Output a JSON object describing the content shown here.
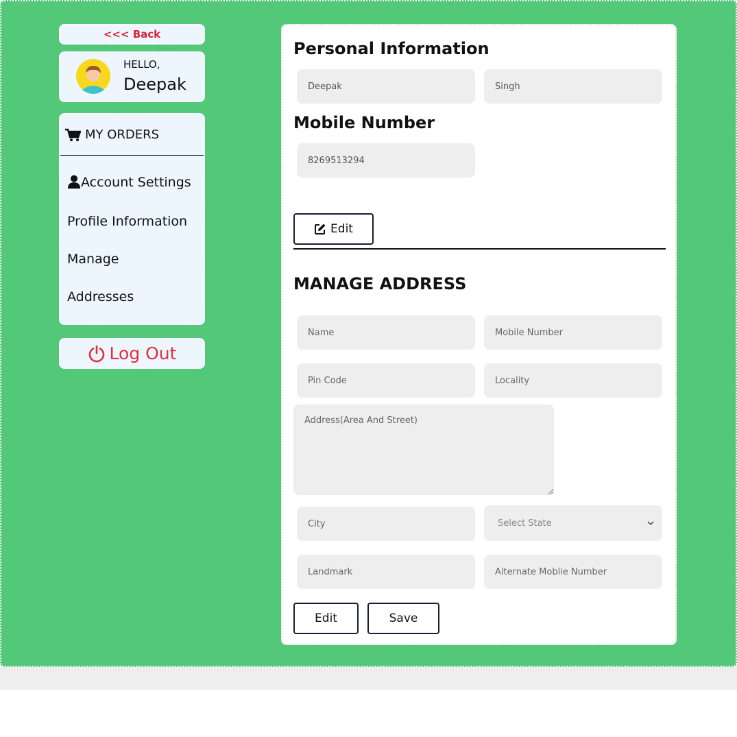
{
  "sidebar": {
    "back_label": "<<< Back",
    "hello_label": "HELLO,",
    "user_name": "Deepak",
    "orders_label": "MY ORDERS",
    "account_settings_label": "Account Settings",
    "profile_information_label": "Profile Information",
    "manage_label": "Manage",
    "addresses_label": "Addresses",
    "logout_label": "Log Out"
  },
  "personal": {
    "title": "Personal Information",
    "first_name": "Deepak",
    "last_name": "Singh",
    "mobile_title": "Mobile Number",
    "mobile_value": "8269513294",
    "edit_label": "Edit"
  },
  "address": {
    "title": "MANAGE ADDRESS",
    "name_placeholder": "Name",
    "mobile_placeholder": "Mobile Number",
    "pincode_placeholder": "Pin Code",
    "locality_placeholder": "Locality",
    "address_placeholder": "Address(Area And Street)",
    "city_placeholder": "City",
    "state_selected": "Select State",
    "landmark_placeholder": "Landmark",
    "alt_mobile_placeholder": "Alternate Moblie Number",
    "edit_label": "Edit",
    "save_label": "Save"
  },
  "colors": {
    "background": "#52c878",
    "card": "#eef6fd",
    "accent_red": "#e0203a",
    "field": "#eeeeee"
  }
}
